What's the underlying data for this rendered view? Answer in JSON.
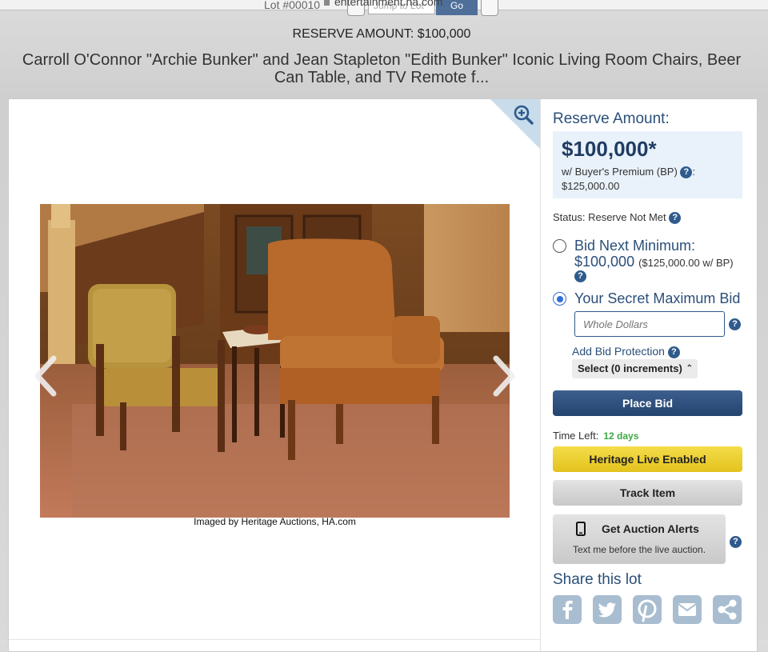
{
  "topbar": {
    "url": "entertainment.ha.com",
    "lot_peek": "Lot #00010",
    "jump_placeholder": "Jump to Lot",
    "go_label": "Go"
  },
  "header": {
    "reserve_line": "RESERVE AMOUNT: $100,000",
    "title": "Carroll O'Connor \"Archie Bunker\" and Jean Stapleton \"Edith Bunker\" Iconic Living Room Chairs, Beer Can Table, and TV Remote f..."
  },
  "image": {
    "caption": "Imaged by Heritage Auctions, HA.com",
    "zoom_icon": "zoom-in-icon",
    "prev_icon": "chevron-left-icon",
    "next_icon": "chevron-right-icon"
  },
  "bidding": {
    "reserve_label": "Reserve Amount:",
    "reserve_amount": "$100,000*",
    "bp_text": "w/ Buyer's Premium (BP)",
    "bp_colon": ":",
    "bp_amount": "$125,000.00",
    "status": "Status: Reserve Not Met",
    "help_glyph": "?",
    "option_next_min_label": "Bid Next Minimum:",
    "option_next_min_amount": "$100,000",
    "option_next_min_bp": "($125,000.00 w/ BP)",
    "option_secret_label": "Your Secret Maximum Bid",
    "input_placeholder": "Whole Dollars",
    "add_protection": "Add Bid Protection",
    "protection_select": "Select (0 increments)",
    "place_bid": "Place Bid",
    "time_left_label": "Time Left:",
    "time_left_value": "12 days",
    "live_button": "Heritage Live Enabled",
    "track_button": "Track Item",
    "alerts_title": "Get Auction Alerts",
    "alerts_sub": "Text me before the live auction.",
    "share_label": "Share this lot",
    "share_icons": [
      "facebook-icon",
      "twitter-icon",
      "pinterest-icon",
      "email-icon",
      "share-icon"
    ]
  },
  "colors": {
    "brand_blue": "#24446f",
    "link_blue": "#2b4f79",
    "live_yellow": "#f4dd4a",
    "days_green": "#3ea744"
  }
}
